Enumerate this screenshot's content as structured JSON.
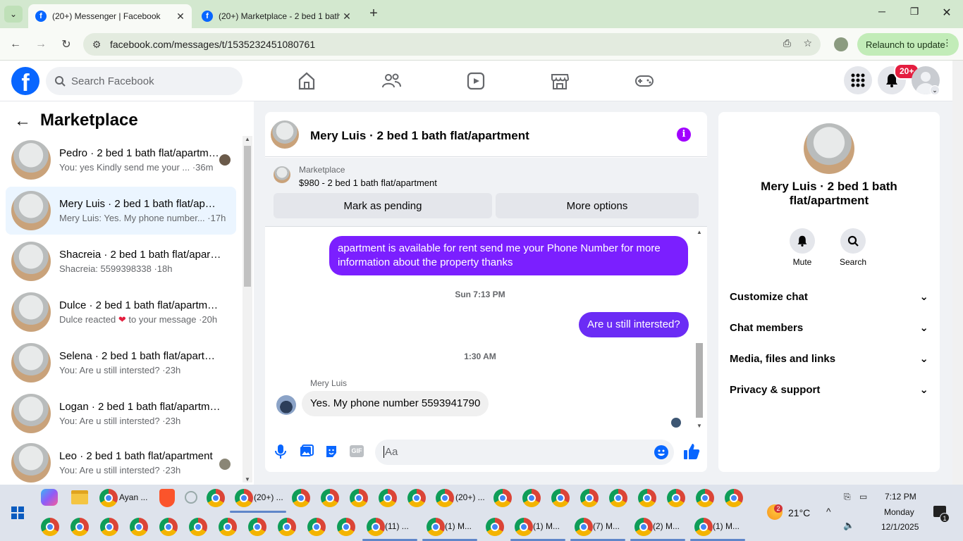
{
  "browser": {
    "tabs": [
      {
        "title": "(20+) Messenger | Facebook",
        "active": true
      },
      {
        "title": "(20+) Marketplace - 2 bed 1 bath",
        "active": false
      }
    ],
    "url": "facebook.com/messages/t/1535232451080761",
    "relaunch": "Relaunch to update"
  },
  "fb": {
    "search_placeholder": "Search Facebook",
    "notif_badge": "20+"
  },
  "left": {
    "title": "Marketplace",
    "items": [
      {
        "name": "Pedro · 2 bed 1 bath flat/apartment",
        "msg": "You: yes Kindly send me your ... ·36m"
      },
      {
        "name": "Mery Luis · 2 bed 1 bath flat/apartment",
        "msg": "Mery Luis: Yes. My phone number... ·17h"
      },
      {
        "name": "Shacreia · 2 bed 1 bath flat/apartment",
        "msg": "Shacreia: 5599398338 ·18h"
      },
      {
        "name": "Dulce · 2 bed 1 bath flat/apartment",
        "msg_a": "Dulce reacted",
        "msg_b": "to your message ·20h"
      },
      {
        "name": "Selena · 2 bed 1 bath flat/apartment",
        "msg": "You: Are u still intersted? ·23h"
      },
      {
        "name": "Logan · 2 bed 1 bath flat/apartment",
        "msg": "You: Are u still intersted? ·23h"
      },
      {
        "name": "Leo · 2 bed 1 bath flat/apartment",
        "msg": "You: Are u still intersted? ·23h"
      }
    ]
  },
  "chat": {
    "header": "Mery Luis · 2 bed 1 bath flat/apartment",
    "listing": {
      "label": "Marketplace",
      "title": "$980 - 2 bed 1 bath flat/apartment"
    },
    "mark_pending": "Mark as pending",
    "more_options": "More options",
    "messages": {
      "out1": "apartment is available for rent send me your Phone Number for more information about the property thanks",
      "ts1": "Sun 7:13 PM",
      "out2": "Are u still intersted?",
      "ts2": "1:30 AM",
      "sender": "Mery Luis",
      "in1": "Yes.  My phone number 5593941790"
    },
    "composer_placeholder": "Aa"
  },
  "right": {
    "name": "Mery Luis · 2 bed 1 bath flat/apartment",
    "mute": "Mute",
    "search": "Search",
    "sections": [
      "Customize chat",
      "Chat members",
      "Media, files and links",
      "Privacy & support"
    ]
  },
  "taskbar": {
    "row1": [
      "Ayan ...",
      "(20+) ...",
      "(20+) ..."
    ],
    "row2": [
      "(11) ...",
      "(1) M...",
      "(1) M...",
      "(7) M...",
      "(2) M...",
      "(1) M..."
    ],
    "weather": "21°C",
    "weather_badge": "2",
    "time": "7:12 PM",
    "day": "Monday",
    "date": "12/1/2025",
    "notif": "1"
  }
}
